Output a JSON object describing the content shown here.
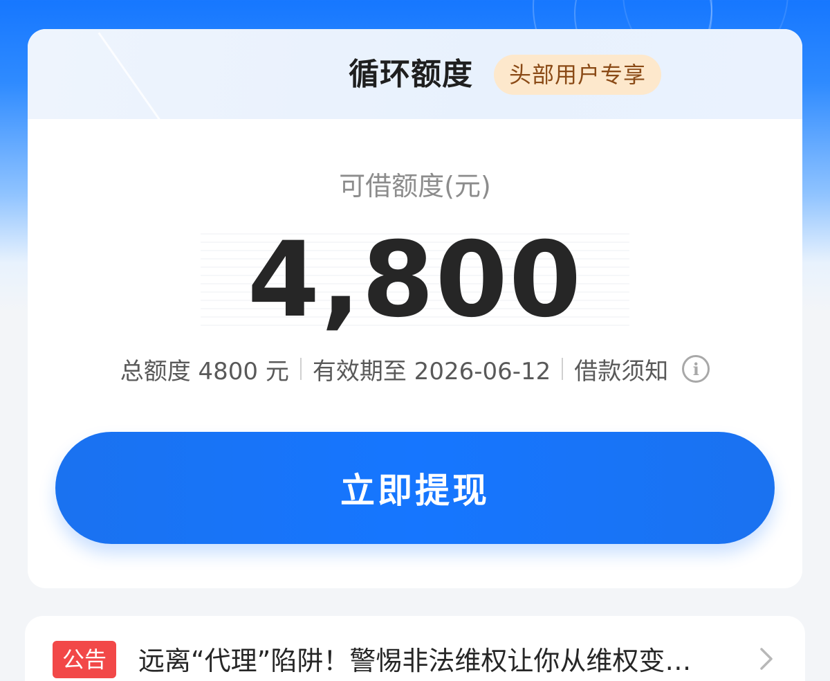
{
  "card": {
    "title": "循环额度",
    "badge": "头部用户专享",
    "available_label": "可借额度(元)",
    "available_amount": "4,800",
    "total_label": "总额度 4800 元",
    "validity_label": "有效期至 2026-06-12",
    "notice_link_label": "借款须知",
    "withdraw_button_label": "立即提现"
  },
  "notice": {
    "badge": "公告",
    "text": "远离“代理”陷阱！警惕非法维权让你从维权变…"
  },
  "icons": {
    "info": "info-icon",
    "chevron": "chevron-right-icon"
  },
  "colors": {
    "primary": "#1677ff",
    "badge_bg": "#fde8cc",
    "badge_text": "#8a4a16",
    "notice_badge": "#f24848"
  }
}
